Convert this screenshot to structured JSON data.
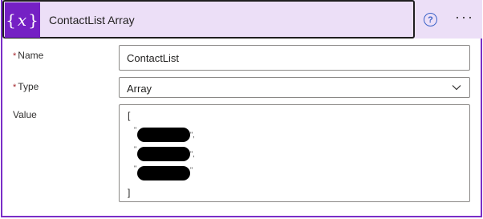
{
  "header": {
    "title": "ContactList Array",
    "icon_text": "{x}",
    "help_symbol": "?",
    "more_symbol": "···"
  },
  "fields": {
    "name": {
      "label": "Name",
      "required_mark": "*",
      "value": "ContactList"
    },
    "type": {
      "label": "Type",
      "required_mark": "*",
      "value": "Array"
    },
    "value": {
      "label": "Value",
      "open_bracket": "[",
      "close_bracket": "]",
      "items": [
        {
          "quote_open": "\"",
          "quote_close": "\",",
          "redacted": true
        },
        {
          "quote_open": "\"",
          "quote_close": "\",",
          "redacted": true
        },
        {
          "quote_open": "\"",
          "quote_close": "\"",
          "redacted": true
        }
      ]
    }
  },
  "colors": {
    "accent": "#7520c4",
    "header_bg": "#ecdff7",
    "border": "#7a2ec7",
    "required": "#a4262c",
    "help": "#3b63c8"
  },
  "icons": {
    "variable": "variable-icon",
    "help": "help-icon",
    "more": "more-icon",
    "dropdown": "chevron-down-icon"
  }
}
